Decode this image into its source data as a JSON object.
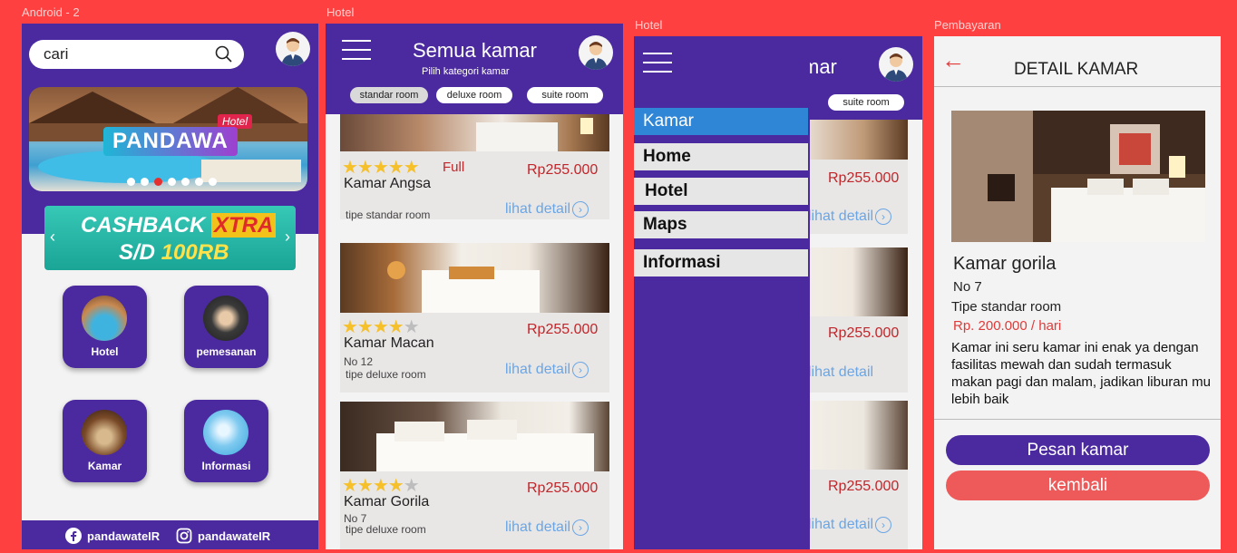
{
  "frames": {
    "android": "Android - 2",
    "hotel1": "Hotel",
    "hotel2": "Hotel",
    "payment": "Pembayaran"
  },
  "home": {
    "search_value": "cari",
    "banner_brand": "PANDAWA",
    "banner_tag": "Hotel",
    "cashback_line1": "CASHBACK",
    "cashback_xtra": "XTRA",
    "cashback_line2_prefix": "S/D",
    "cashback_line2_amount": "100RB",
    "tiles": [
      {
        "label": "Hotel"
      },
      {
        "label": "pemesanan"
      },
      {
        "label": "Kamar"
      },
      {
        "label": "Informasi"
      }
    ],
    "footer": {
      "facebook": "pandawateIR",
      "instagram": "pandawateIR"
    }
  },
  "rooms": {
    "title": "Semua kamar",
    "subtitle": "Pilih kategori kamar",
    "categories": [
      "standar room",
      "deluxe room",
      "suite room"
    ],
    "cards": [
      {
        "name": "Kamar Angsa",
        "status": "Full",
        "price": "Rp255.000",
        "no": "",
        "type": "tipe standar room",
        "stars": 5,
        "link": "lihat detail"
      },
      {
        "name": "Kamar Macan",
        "status": "",
        "price": "Rp255.000",
        "no": "No 12",
        "type": "tipe deluxe room",
        "stars": 4,
        "link": "lihat detail"
      },
      {
        "name": "Kamar Gorila",
        "status": "",
        "price": "Rp255.000",
        "no": "No 7",
        "type": "tipe deluxe room",
        "stars": 4,
        "link": "lihat detail"
      }
    ]
  },
  "drawer": {
    "title_partial": "mar",
    "pill_partial": "suite room",
    "items": [
      "Kamar",
      "Home",
      "Hotel",
      "Maps",
      "Informasi"
    ],
    "prices": [
      "Rp255.000",
      "Rp255.000",
      "Rp255.000"
    ],
    "links": [
      "lihat detail",
      "lihat detail",
      "lihat detail"
    ]
  },
  "detail": {
    "title": "DETAIL KAMAR",
    "room_name": "Kamar gorila",
    "no": "No 7",
    "type": "Tipe standar room",
    "price": "Rp. 200.000 / hari",
    "description": "Kamar ini seru kamar ini enak ya dengan fasilitas mewah dan sudah termasuk makan pagi dan malam, jadikan liburan mu lebih baik",
    "order_button": "Pesan kamar",
    "back_button": "kembali"
  },
  "colors": {
    "purple": "#4b2aa0",
    "red_bg": "#ff4040",
    "price_red": "#c0262a",
    "link_blue": "#6aa6e6",
    "star_yellow": "#f5c02a",
    "drawer_active": "#2f86d6"
  }
}
